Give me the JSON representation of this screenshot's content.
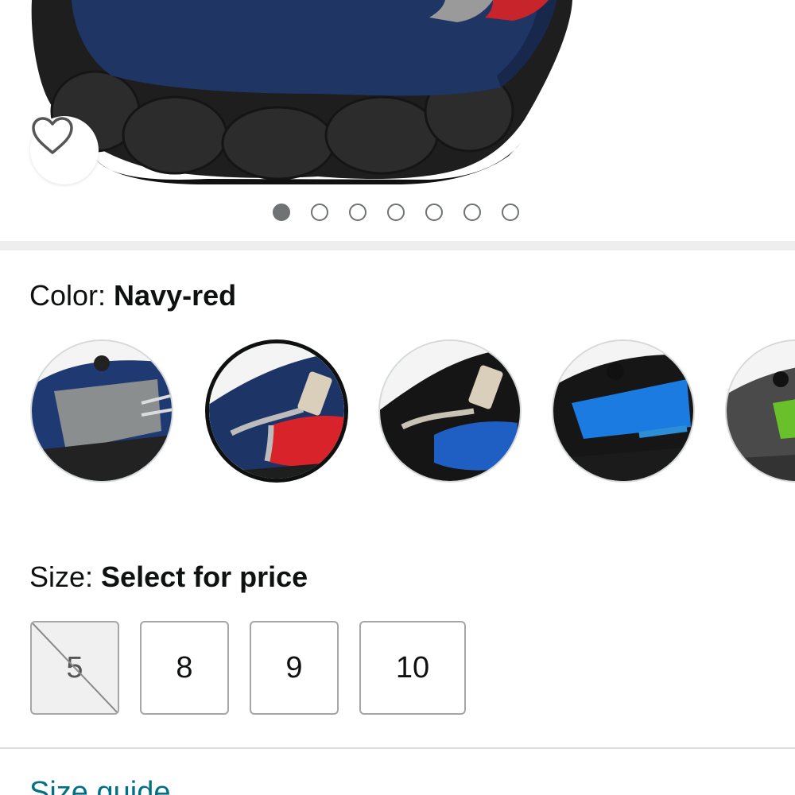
{
  "product_image": {
    "alt_icon": "shoe-photo",
    "wishlist_icon": "heart-icon"
  },
  "carousel": {
    "count": 7,
    "active_index": 0
  },
  "color": {
    "label": "Color: ",
    "selected_value": "Navy-red",
    "options": [
      {
        "name": "swatch-navy-grey",
        "colors": [
          "#1f3a73",
          "#8a8e8e",
          "#222222"
        ]
      },
      {
        "name": "swatch-navy-red",
        "colors": [
          "#1d3466",
          "#d8232a",
          "#bcbcbc"
        ],
        "selected": true
      },
      {
        "name": "swatch-black-blue",
        "colors": [
          "#151515",
          "#1f5fc4",
          "#c9c3b5"
        ]
      },
      {
        "name": "swatch-black-royal",
        "colors": [
          "#161616",
          "#1c7be0",
          "#2d8ed8"
        ]
      },
      {
        "name": "swatch-grey-green",
        "colors": [
          "#4a4a4a",
          "#68c12b",
          "#333333"
        ]
      }
    ]
  },
  "size": {
    "label": "Size: ",
    "selected_value": "Select for price",
    "options": [
      {
        "label": "5",
        "available": false
      },
      {
        "label": "8",
        "available": true
      },
      {
        "label": "9",
        "available": true
      },
      {
        "label": "10",
        "available": true
      }
    ]
  },
  "links": {
    "size_guide": "Size guide"
  }
}
